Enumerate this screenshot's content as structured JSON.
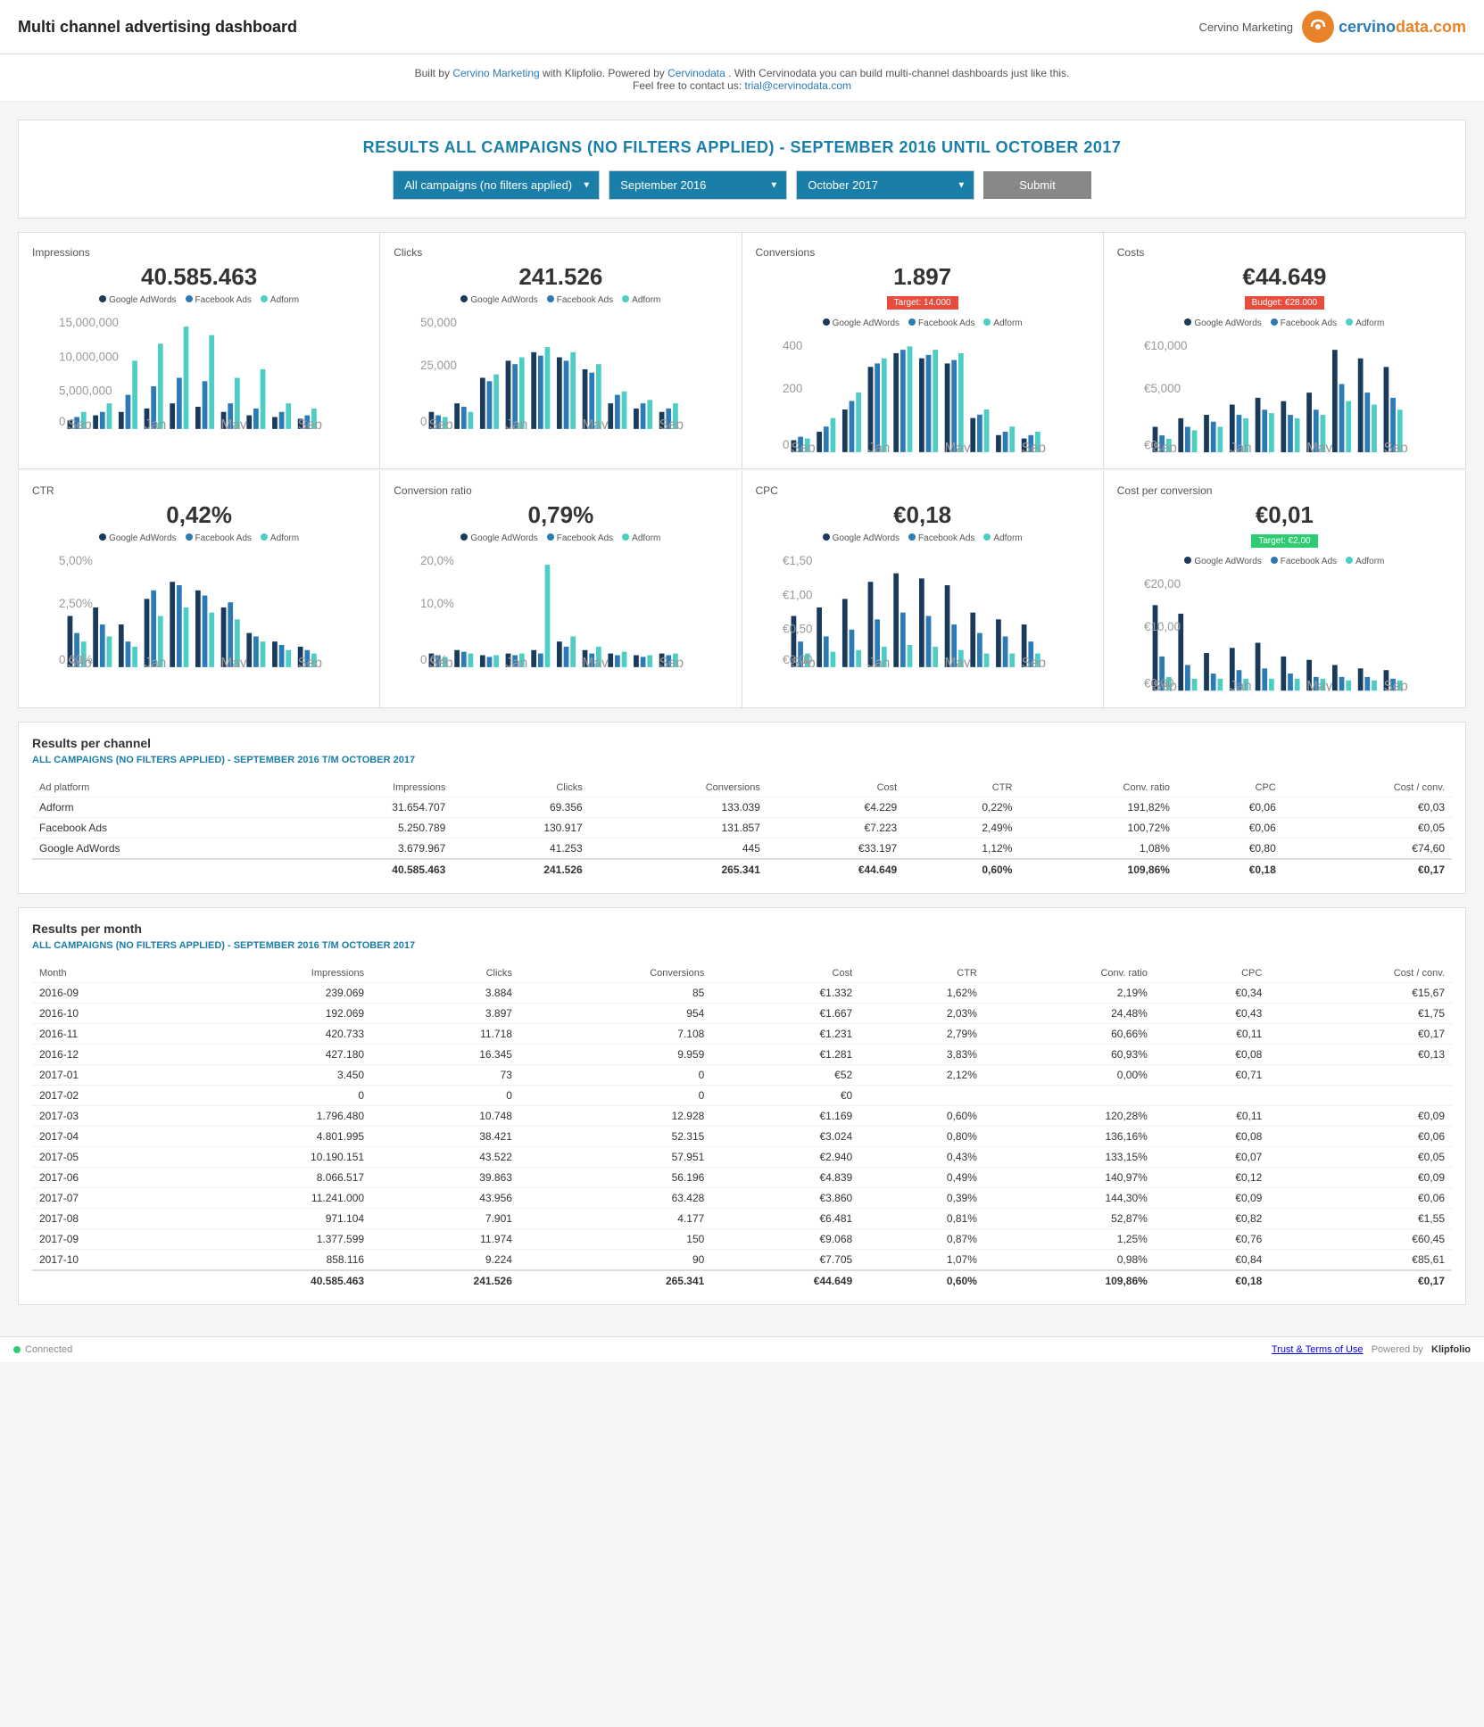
{
  "header": {
    "title": "Multi channel advertising dashboard",
    "company": "Cervino Marketing",
    "logo_letter": "C",
    "logo_brand": "cervinodata.com"
  },
  "promo": {
    "line1_prefix": "Built by ",
    "line1_link1": "Cervino Marketing",
    "line1_mid": " with Klipfolio. Powered by ",
    "line1_link2": "Cervinodata",
    "line1_suffix": ". With Cervinodata you can build multi-channel dashboards just like this.",
    "line2_prefix": "Feel free to contact us: ",
    "line2_email": "trial@cervinodata.com"
  },
  "campaign": {
    "title": "RESULTS ALL CAMPAIGNS (NO FILTERS APPLIED) - SEPTEMBER 2016 UNTIL OCTOBER 2017",
    "filter_campaign_label": "All campaigns (no filters applied)",
    "filter_start": "September 2016",
    "filter_end": "October 2017",
    "submit_label": "Submit"
  },
  "metrics_row1": [
    {
      "id": "impressions",
      "label": "Impressions",
      "value": "40.585.463",
      "target": null,
      "budget": null
    },
    {
      "id": "clicks",
      "label": "Clicks",
      "value": "241.526",
      "target": null,
      "budget": null
    },
    {
      "id": "conversions",
      "label": "Conversions",
      "value": "1.897",
      "target": "Target: 14.000",
      "budget": null
    },
    {
      "id": "costs",
      "label": "Costs",
      "value": "€44.649",
      "target": null,
      "budget": "Budget: €28.000"
    }
  ],
  "metrics_row2": [
    {
      "id": "ctr",
      "label": "CTR",
      "value": "0,42%",
      "target": null
    },
    {
      "id": "conv_ratio",
      "label": "Conversion ratio",
      "value": "0,79%",
      "target": null
    },
    {
      "id": "cpc",
      "label": "CPC",
      "value": "€0,18",
      "target": null
    },
    {
      "id": "cost_per_conv",
      "label": "Cost per conversion",
      "value": "€0,01",
      "target": "Target: €2,00",
      "target_color": "#2ecc71"
    }
  ],
  "legend": {
    "adwords": "Google AdWords",
    "facebook": "Facebook Ads",
    "adform": "Adform"
  },
  "x_labels": [
    "Sep",
    "Jan",
    "May",
    "Sep"
  ],
  "channel_section": {
    "title": "Results per channel",
    "subtitle": "ALL CAMPAIGNS (NO FILTERS APPLIED) - SEPTEMBER 2016 T/M OCTOBER 2017",
    "columns": [
      "Ad platform",
      "Impressions",
      "Clicks",
      "Conversions",
      "Cost",
      "CTR",
      "Conv. ratio",
      "CPC",
      "Cost / conv."
    ],
    "rows": [
      [
        "Adform",
        "31.654.707",
        "69.356",
        "133.039",
        "€4.229",
        "0,22%",
        "191,82%",
        "€0,06",
        "€0,03"
      ],
      [
        "Facebook Ads",
        "5.250.789",
        "130.917",
        "131.857",
        "€7.223",
        "2,49%",
        "100,72%",
        "€0,06",
        "€0,05"
      ],
      [
        "Google AdWords",
        "3.679.967",
        "41.253",
        "445",
        "€33.197",
        "1,12%",
        "1,08%",
        "€0,80",
        "€74,60"
      ]
    ],
    "total_row": [
      "",
      "40.585.463",
      "241.526",
      "265.341",
      "€44.649",
      "0,60%",
      "109,86%",
      "€0,18",
      "€0,17"
    ]
  },
  "month_section": {
    "title": "Results per month",
    "subtitle": "ALL CAMPAIGNS (NO FILTERS APPLIED) - SEPTEMBER 2016 T/M OCTOBER 2017",
    "columns": [
      "Month",
      "Impressions",
      "Clicks",
      "Conversions",
      "Cost",
      "CTR",
      "Conv. ratio",
      "CPC",
      "Cost / conv."
    ],
    "rows": [
      [
        "2016-09",
        "239.069",
        "3.884",
        "85",
        "€1.332",
        "1,62%",
        "2,19%",
        "€0,34",
        "€15,67"
      ],
      [
        "2016-10",
        "192.069",
        "3.897",
        "954",
        "€1.667",
        "2,03%",
        "24,48%",
        "€0,43",
        "€1,75"
      ],
      [
        "2016-11",
        "420.733",
        "11.718",
        "7.108",
        "€1.231",
        "2,79%",
        "60,66%",
        "€0,11",
        "€0,17"
      ],
      [
        "2016-12",
        "427.180",
        "16.345",
        "9.959",
        "€1.281",
        "3,83%",
        "60,93%",
        "€0,08",
        "€0,13"
      ],
      [
        "2017-01",
        "3.450",
        "73",
        "0",
        "€52",
        "2,12%",
        "0,00%",
        "€0,71",
        ""
      ],
      [
        "2017-02",
        "0",
        "0",
        "0",
        "€0",
        "",
        "",
        "",
        ""
      ],
      [
        "2017-03",
        "1.796.480",
        "10.748",
        "12.928",
        "€1.169",
        "0,60%",
        "120,28%",
        "€0,11",
        "€0,09"
      ],
      [
        "2017-04",
        "4.801.995",
        "38.421",
        "52.315",
        "€3.024",
        "0,80%",
        "136,16%",
        "€0,08",
        "€0,06"
      ],
      [
        "2017-05",
        "10.190.151",
        "43.522",
        "57.951",
        "€2.940",
        "0,43%",
        "133,15%",
        "€0,07",
        "€0,05"
      ],
      [
        "2017-06",
        "8.066.517",
        "39.863",
        "56.196",
        "€4.839",
        "0,49%",
        "140,97%",
        "€0,12",
        "€0,09"
      ],
      [
        "2017-07",
        "11.241.000",
        "43.956",
        "63.428",
        "€3.860",
        "0,39%",
        "144,30%",
        "€0,09",
        "€0,06"
      ],
      [
        "2017-08",
        "971.104",
        "7.901",
        "4.177",
        "€6.481",
        "0,81%",
        "52,87%",
        "€0,82",
        "€1,55"
      ],
      [
        "2017-09",
        "1.377.599",
        "11.974",
        "150",
        "€9.068",
        "0,87%",
        "1,25%",
        "€0,76",
        "€60,45"
      ],
      [
        "2017-10",
        "858.116",
        "9.224",
        "90",
        "€7.705",
        "1,07%",
        "0,98%",
        "€0,84",
        "€85,61"
      ]
    ],
    "total_row": [
      "",
      "40.585.463",
      "241.526",
      "265.341",
      "€44.649",
      "0,60%",
      "109,86%",
      "€0,18",
      "€0,17"
    ]
  },
  "footer": {
    "connected": "Connected",
    "trust_terms": "Trust & Terms of Use",
    "powered_by": "Powered by",
    "klipfolio": "Klipfolio"
  }
}
